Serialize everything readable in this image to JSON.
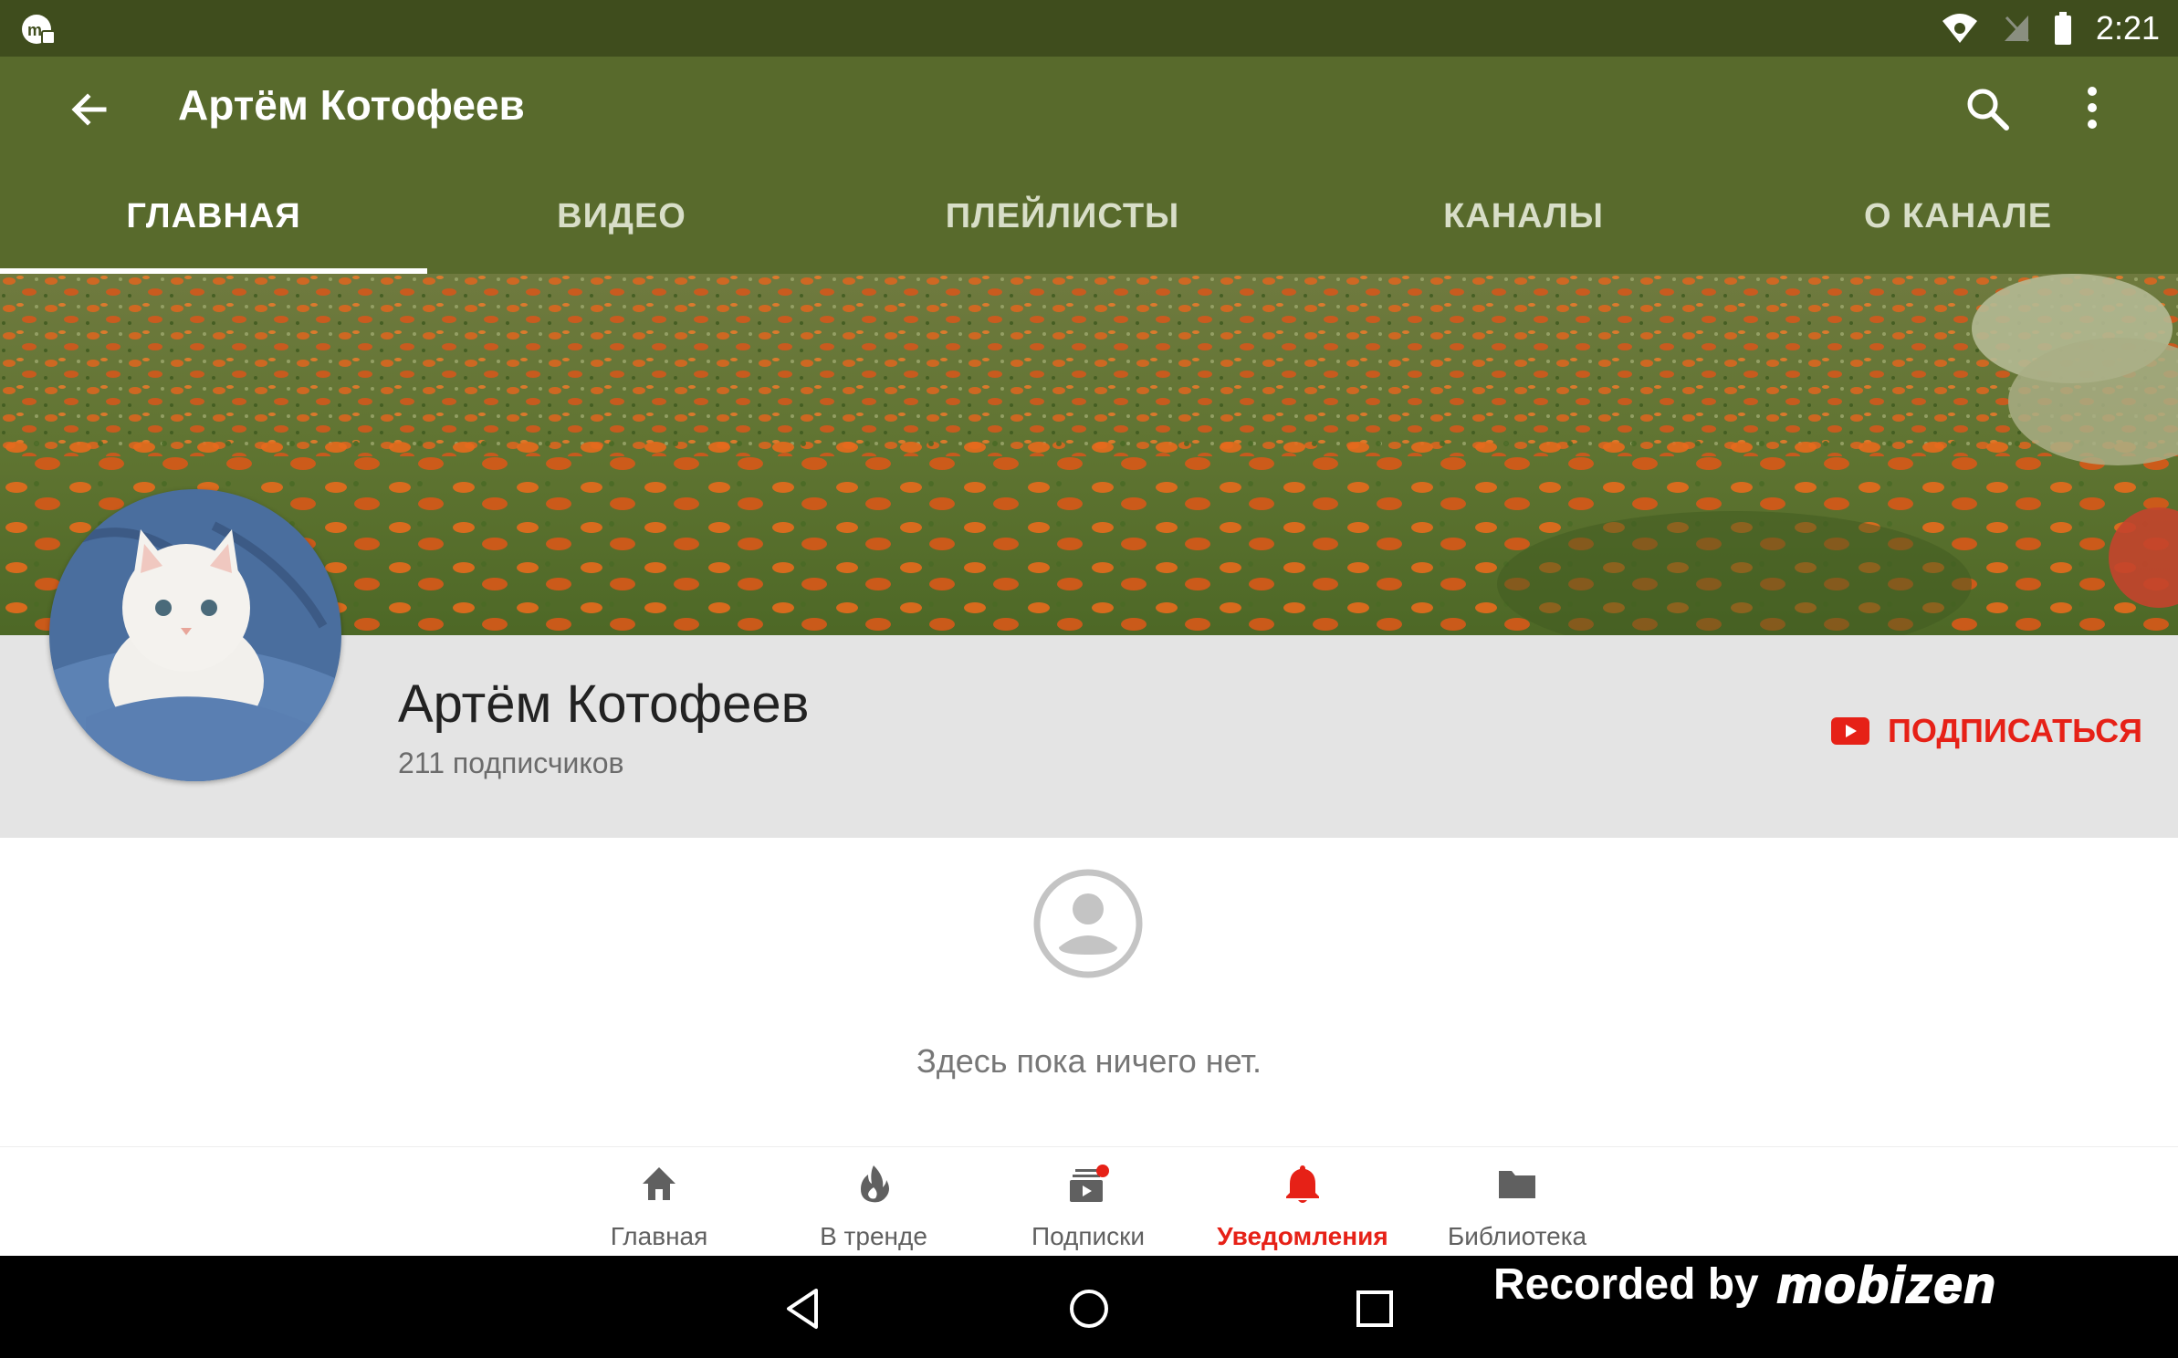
{
  "status_bar": {
    "time": "2:21",
    "app_icon": "mobizen-notification-icon",
    "wifi_icon": "wifi-icon",
    "signal_icon": "no-signal-icon",
    "battery_icon": "battery-icon"
  },
  "app_bar": {
    "title": "Артём Котофеев",
    "back_icon": "arrow-back-icon",
    "search_icon": "search-icon",
    "more_icon": "more-vert-icon"
  },
  "tabs": [
    {
      "label": "ГЛАВНАЯ",
      "active": true
    },
    {
      "label": "ВИДЕО"
    },
    {
      "label": "ПЛЕЙЛИСТЫ"
    },
    {
      "label": "КАНАЛЫ"
    },
    {
      "label": "О КАНАЛЕ"
    }
  ],
  "channel": {
    "name": "Артём Котофеев",
    "subscribers": "211 подписчиков",
    "subscribe_label": "ПОДПИСАТЬСЯ",
    "avatar": "kitten-avatar",
    "banner": "orange-poppy-field-banner"
  },
  "empty_state": {
    "icon": "account-circle-icon",
    "text": "Здесь пока ничего нет."
  },
  "bottom_nav": [
    {
      "label": "Главная",
      "icon": "home-icon"
    },
    {
      "label": "В тренде",
      "icon": "trending-flame-icon"
    },
    {
      "label": "Подписки",
      "icon": "subscriptions-icon"
    },
    {
      "label": "Уведомления",
      "icon": "bell-icon",
      "active": true
    },
    {
      "label": "Библиотека",
      "icon": "folder-icon"
    }
  ],
  "system_nav": {
    "back": "nav-back-icon",
    "home": "nav-home-icon",
    "recents": "nav-recents-icon"
  },
  "watermark": {
    "text": "Recorded by",
    "logo": "mobizen"
  },
  "colors": {
    "app_bar": "#586a2c",
    "status_bar": "#3f4d1d",
    "accent_red": "#e62117",
    "info_bg": "#e4e4e4"
  }
}
